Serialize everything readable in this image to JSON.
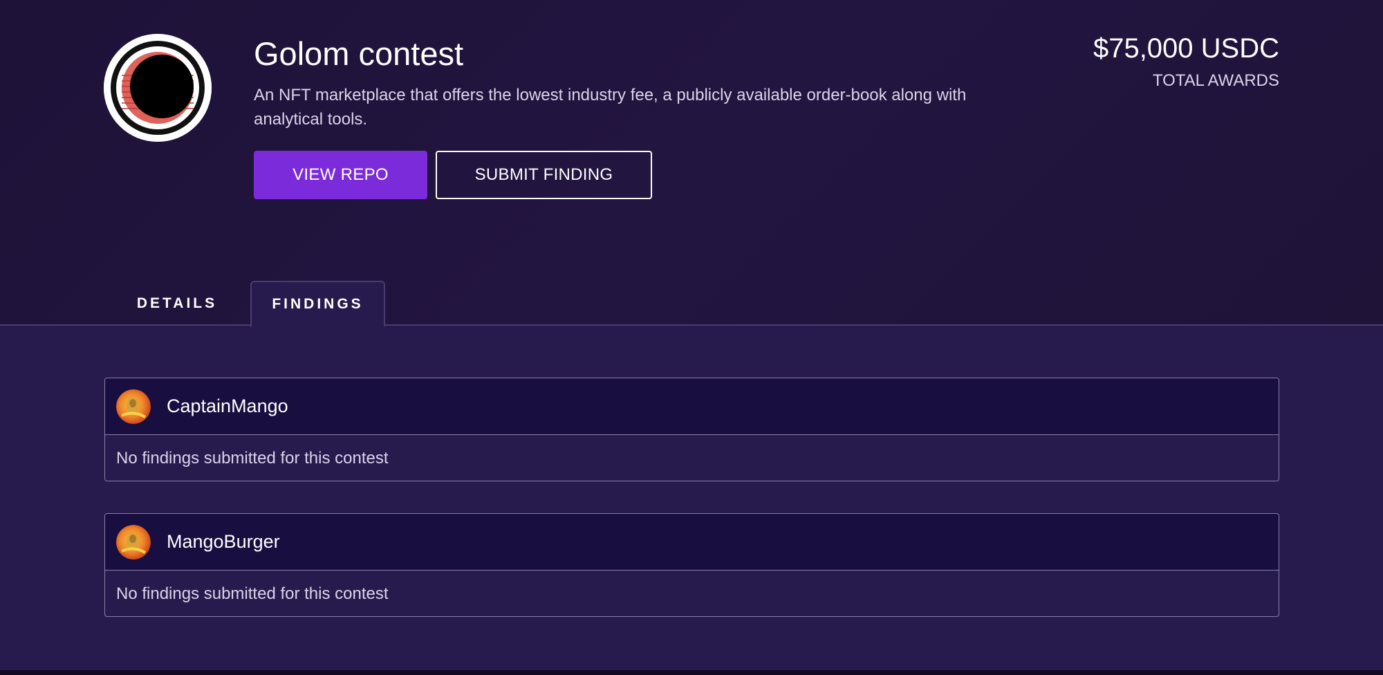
{
  "contest": {
    "title": "Golom contest",
    "description": "An NFT marketplace that offers the lowest industry fee, a publicly available order-book along with analytical tools.",
    "logo_icon": "golom-logo-icon"
  },
  "actions": {
    "view_repo_label": "VIEW REPO",
    "submit_finding_label": "SUBMIT FINDING"
  },
  "prize": {
    "amount": "$75,000 USDC",
    "label": "TOTAL AWARDS"
  },
  "tabs": [
    {
      "label": "DETAILS",
      "active": false
    },
    {
      "label": "FINDINGS",
      "active": true
    }
  ],
  "findings": [
    {
      "handle": "CaptainMango",
      "status": "No findings submitted for this contest"
    },
    {
      "handle": "MangoBurger",
      "status": "No findings submitted for this contest"
    }
  ],
  "colors": {
    "accent": "#7b2bd9",
    "hero_bg": "#1e1238",
    "content_bg": "#271b4e",
    "card_header_bg": "#190e40"
  }
}
